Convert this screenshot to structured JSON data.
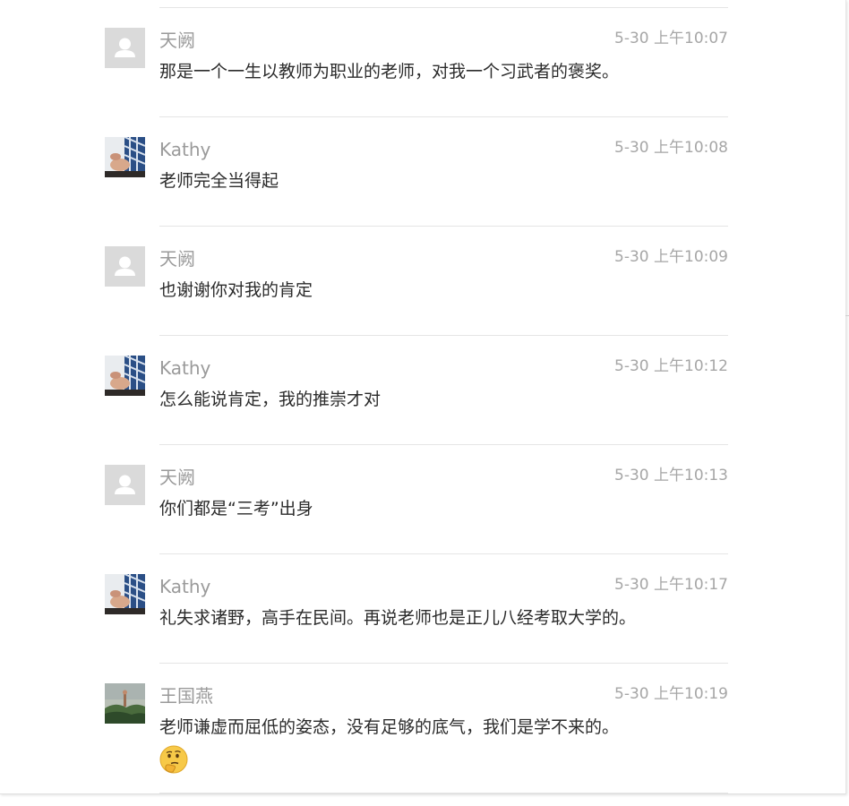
{
  "comments": [
    {
      "nick": "天阙",
      "time": "5-30 上午10:07",
      "text": "那是一个一生以教师为职业的老师，对我一个习武者的褒奖。",
      "avatar": "default-avatar"
    },
    {
      "nick": "Kathy",
      "time": "5-30 上午10:08",
      "text": "老师完全当得起",
      "avatar": "photo-avatar"
    },
    {
      "nick": "天阙",
      "time": "5-30 上午10:09",
      "text": "也谢谢你对我的肯定",
      "avatar": "default-avatar"
    },
    {
      "nick": "Kathy",
      "time": "5-30 上午10:12",
      "text": "怎么能说肯定，我的推崇才对",
      "avatar": "photo-avatar"
    },
    {
      "nick": "天阙",
      "time": "5-30 上午10:13",
      "text": "你们都是“三考”出身",
      "avatar": "default-avatar"
    },
    {
      "nick": "Kathy",
      "time": "5-30 上午10:17",
      "text": "礼失求诸野，高手在民间。再说老师也是正儿八经考取大学的。",
      "avatar": "photo-avatar"
    },
    {
      "nick": "王国燕",
      "time": "5-30 上午10:19",
      "text": "老师谦虚而屈低的姿态，没有足够的底气，我们是学不来的。",
      "avatar": "landscape-avatar",
      "emoji": "thinking-face-emoji"
    }
  ],
  "colors": {
    "nick": "#9a9a9a",
    "time": "#a6a6a6",
    "text": "#2b2b2b",
    "divider": "#e5e5e5"
  }
}
